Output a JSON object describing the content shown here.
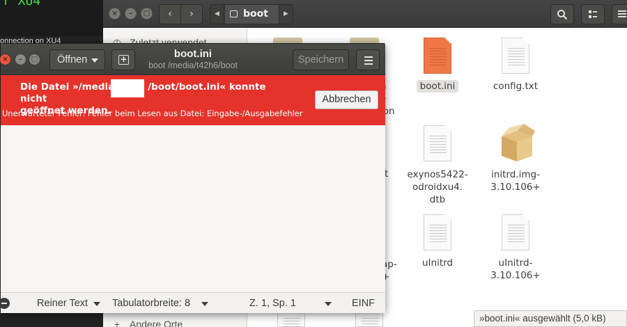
{
  "terminal": {
    "title": "r XU4",
    "line": "onnection on XU4"
  },
  "file_manager": {
    "path_segment": "boot",
    "sidebar": [
      {
        "label": "Zuletzt verwendet",
        "icon": "clock-icon"
      },
      {
        "label": "Andere Orte",
        "icon": "plus-icon"
      }
    ],
    "files": [
      {
        "label": "boot.ini",
        "icon": "text-file-icon",
        "selected": true
      },
      {
        "label": "config.txt",
        "icon": "text-file-icon"
      },
      {
        "label": "exynos5422-odroidxu4.dtb",
        "lines": [
          "exynos5422-",
          "odroidxu4.",
          "dtb"
        ],
        "icon": "text-file-icon"
      },
      {
        "label": "initrd.img-3.10.106+",
        "lines": [
          "initrd.img-",
          "3.10.106+"
        ],
        "icon": "archive-icon"
      },
      {
        "label": "uInitrd",
        "icon": "text-file-icon"
      },
      {
        "label": "uInitrd-3.10.106+",
        "lines": [
          "uInitrd-",
          "3.10.106+"
        ],
        "icon": "text-file-icon"
      }
    ],
    "partial_labels": {
      "row1a": "n",
      "row1b": "e",
      "row1c": "ion",
      "row2": "t",
      "row3a": "ap-",
      "row3b": "+"
    },
    "status": "»boot.ini« ausgewählt  (5,0 kB)"
  },
  "gedit": {
    "open_label": "Öffnen",
    "title": "boot.ini",
    "subtitle": "boot /media/t42h6/boot",
    "save_label": "Speichern",
    "error": {
      "title_part1": "Die Datei »/media",
      "title_part2": "/boot/boot.ini« konnte nicht",
      "title_line2": "geöffnet werden.",
      "detail": "Unerwarteter Fehler: Fehler beim Lesen aus Datei: Eingabe-/Ausgabefehler",
      "cancel_label": "Abbrechen"
    },
    "statusbar": {
      "language": "Reiner Text",
      "tab_width": "Tabulatorbreite: 8",
      "position": "Z. 1, Sp. 1",
      "mode": "EINF"
    }
  },
  "colors": {
    "error_bg": "#e5322b",
    "header_bg": "#3d3d3b",
    "terminal_green": "#43e043",
    "file_icon_orange": "#f07746"
  }
}
